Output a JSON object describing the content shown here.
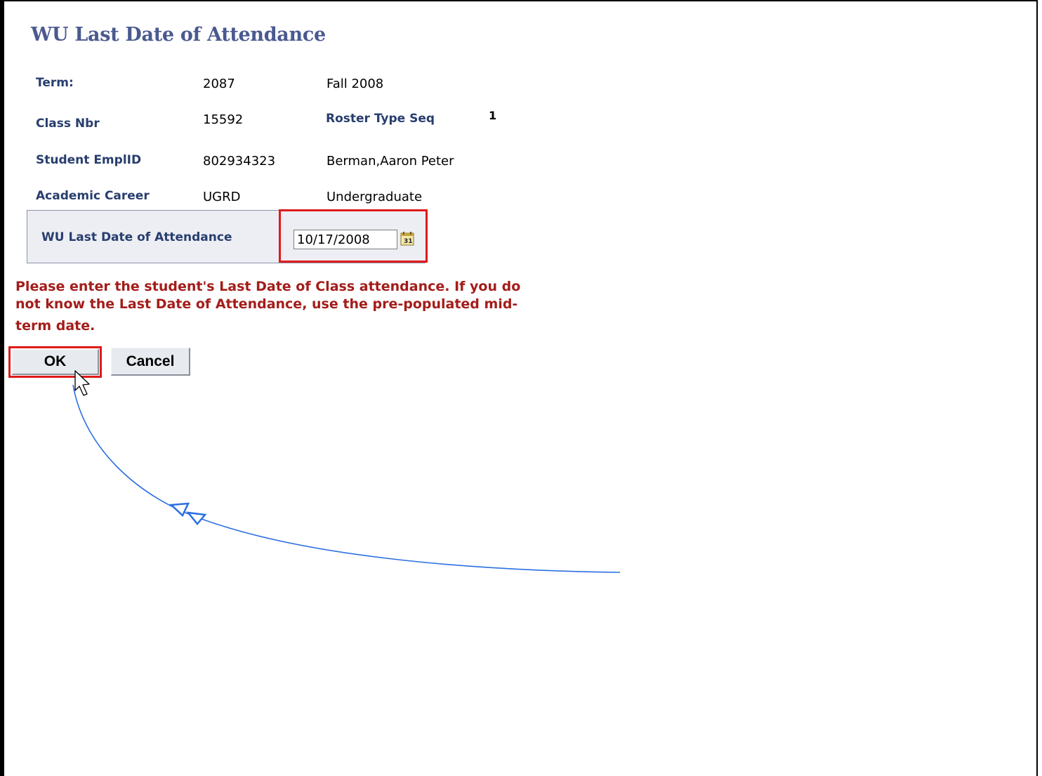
{
  "page": {
    "title": "WU Last Date of Attendance"
  },
  "fields": {
    "term_label": "Term:",
    "term_code": "2087",
    "term_desc": "Fall 2008",
    "class_nbr_label": "Class Nbr",
    "class_nbr": "15592",
    "roster_type_seq_label": "Roster Type Seq",
    "roster_type_seq": "1",
    "student_emplid_label": "Student EmplID",
    "student_emplid": "802934323",
    "student_name": "Berman,Aaron Peter",
    "academic_career_label": "Academic Career",
    "academic_career_code": "UGRD",
    "academic_career_desc": "Undergraduate"
  },
  "last_date": {
    "label": "WU Last Date of Attendance",
    "value": "10/17/2008",
    "calendar_icon": "calendar-icon"
  },
  "message": {
    "line1": "Please enter the student's Last Date of Class attendance. If you do",
    "line2": "not know the Last Date of Attendance, use the pre-populated mid-",
    "line3": "term date.",
    "color": "#a31d1a"
  },
  "buttons": {
    "ok_label": "OK",
    "cancel_label": "Cancel"
  },
  "annotations": {
    "highlight_color": "#e01a1a",
    "arrow_color": "#2b6fe0",
    "cursor_icon": "mouse-pointer-icon"
  }
}
